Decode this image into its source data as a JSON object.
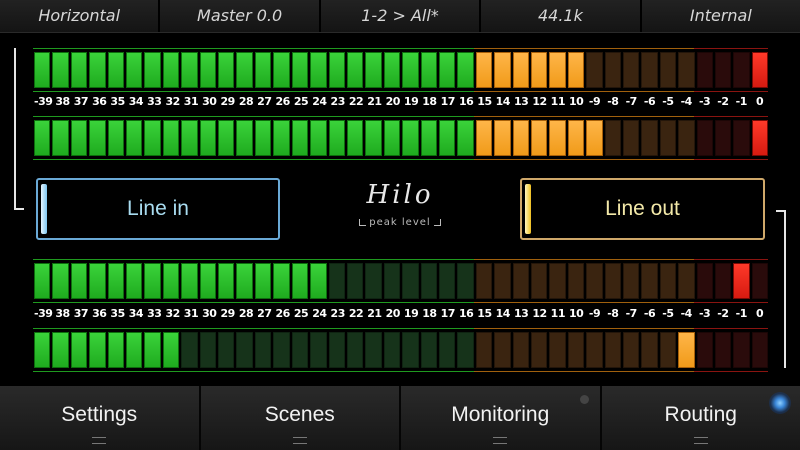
{
  "status_bar": [
    "Horizontal",
    "Master 0.0",
    "1-2 > All*",
    "44.1k",
    "Internal"
  ],
  "scale_labels": [
    "-39",
    "38",
    "37",
    "36",
    "35",
    "34",
    "33",
    "32",
    "31",
    "30",
    "29",
    "28",
    "27",
    "26",
    "25",
    "24",
    "23",
    "22",
    "21",
    "20",
    "19",
    "18",
    "17",
    "16",
    "15",
    "14",
    "13",
    "12",
    "11",
    "10",
    "-9",
    "-8",
    "-7",
    "-6",
    "-5",
    "-4",
    "-3",
    "-2",
    "-1",
    "0"
  ],
  "meters": {
    "input_1": {
      "lit_segments": 30,
      "peak_segment": 40
    },
    "input_2": {
      "lit_segments": 31,
      "peak_segment": 40
    },
    "output_1": {
      "lit_segments": 16,
      "peak_segment": 39
    },
    "output_2": {
      "lit_segments": 8,
      "peak_segment": 36
    }
  },
  "line_in_label": "Line in",
  "line_out_label": "Line out",
  "logo": {
    "word": "Hilo",
    "tagline": "peak level"
  },
  "nav": [
    "Settings",
    "Scenes",
    "Monitoring",
    "Routing"
  ],
  "colors": {
    "green": "#2ac02a",
    "orange": "#f5a623",
    "red": "#e8261a",
    "line_in_accent": "#6aa9d6",
    "line_out_accent": "#cfa86a"
  }
}
